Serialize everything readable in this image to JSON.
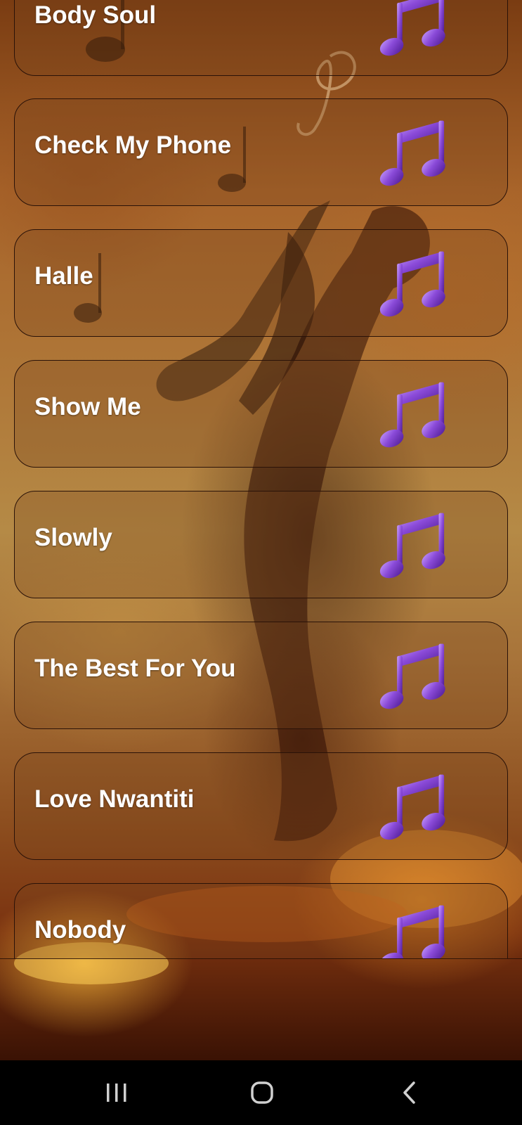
{
  "songs": [
    {
      "title": "Body Soul",
      "icon": "music-note-icon"
    },
    {
      "title": "Check My Phone",
      "icon": "music-note-icon"
    },
    {
      "title": "Halle",
      "icon": "music-note-icon"
    },
    {
      "title": "Show Me",
      "icon": "music-note-icon"
    },
    {
      "title": "Slowly",
      "icon": "music-note-icon"
    },
    {
      "title": "The Best For You",
      "icon": "music-note-icon"
    },
    {
      "title": "Love Nwantiti",
      "icon": "music-note-icon"
    },
    {
      "title": "Nobody",
      "icon": "music-note-icon"
    }
  ],
  "navigation_bar": {
    "buttons": [
      {
        "name": "recent-apps",
        "icon": "recent-apps-icon"
      },
      {
        "name": "home",
        "icon": "home-icon"
      },
      {
        "name": "back",
        "icon": "back-icon"
      }
    ]
  },
  "colors": {
    "card_border": "#2a1208",
    "title_text": "#ffffff",
    "note_icon": "#7b3fc4",
    "nav_background": "#000000",
    "nav_icon": "#d0d0d0"
  }
}
